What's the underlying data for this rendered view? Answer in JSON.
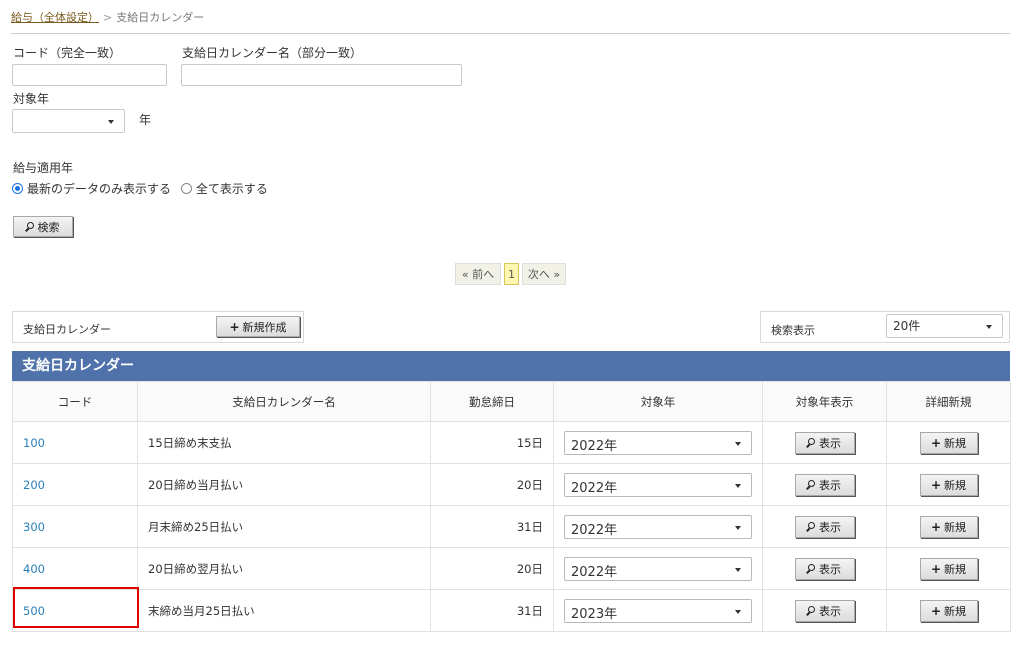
{
  "breadcrumb": {
    "parent": "給与（全体設定）",
    "separator": ">",
    "current": "支給日カレンダー"
  },
  "search_form": {
    "code_label": "コード（完全一致）",
    "code_value": "",
    "name_label": "支給日カレンダー名（部分一致）",
    "name_value": "",
    "year_label": "対象年",
    "year_value": "",
    "year_suffix": "年",
    "apply_label": "給与適用年",
    "radio_latest": "最新のデータのみ表示する",
    "radio_all": "全て表示する",
    "search_button": "検索"
  },
  "pagination": {
    "prev": "« 前へ",
    "current": "1",
    "next": "次へ »"
  },
  "toolbar": {
    "panel_label": "支給日カレンダー",
    "new_button": "新規作成",
    "display_label": "検索表示",
    "display_value": "20件"
  },
  "table": {
    "title": "支給日カレンダー",
    "headers": [
      "コード",
      "支給日カレンダー名",
      "勤怠締日",
      "対象年",
      "対象年表示",
      "詳細新規"
    ],
    "show_button": "表示",
    "new_button": "新規",
    "rows": [
      {
        "code": "100",
        "name": "15日締め末支払",
        "cutoff": "15日",
        "year": "2022年"
      },
      {
        "code": "200",
        "name": "20日締め当月払い",
        "cutoff": "20日",
        "year": "2022年"
      },
      {
        "code": "300",
        "name": "月末締め25日払い",
        "cutoff": "31日",
        "year": "2022年"
      },
      {
        "code": "400",
        "name": "20日締め翌月払い",
        "cutoff": "20日",
        "year": "2022年"
      },
      {
        "code": "500",
        "name": "末締め当月25日払い",
        "cutoff": "31日",
        "year": "2023年"
      }
    ]
  },
  "colors": {
    "accent": "#4f72ab",
    "link": "#2a7fb8",
    "highlight": "#e00000",
    "pager_current": "#fff7b0"
  }
}
